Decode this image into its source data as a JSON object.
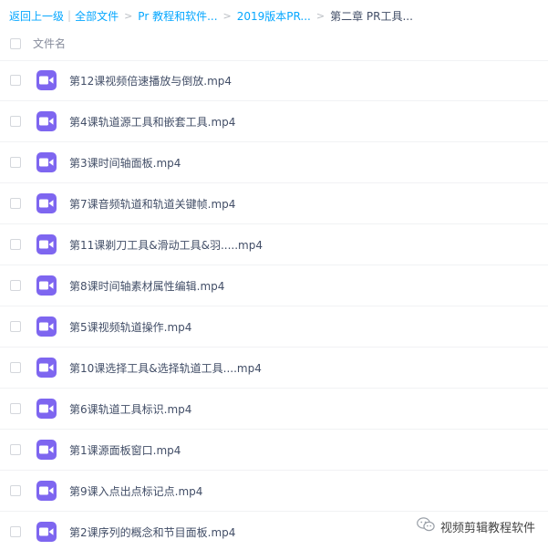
{
  "breadcrumb": {
    "back": "返回上一级",
    "divider": "|",
    "all_files": "全部文件",
    "level1": "Pr 教程和软件...",
    "level2": "2019版本PR...",
    "current": "第二章 PR工具...",
    "arrow": ">"
  },
  "header": {
    "column_label": "文件名"
  },
  "files": [
    {
      "name": "第12课视频倍速播放与倒放.mp4",
      "icon": "video-file-icon"
    },
    {
      "name": "第4课轨道源工具和嵌套工具.mp4",
      "icon": "video-file-icon"
    },
    {
      "name": "第3课时间轴面板.mp4",
      "icon": "video-file-icon"
    },
    {
      "name": "第7课音频轨道和轨道关键帧.mp4",
      "icon": "video-file-icon"
    },
    {
      "name": "第11课剃刀工具&滑动工具&羽.....mp4",
      "icon": "video-file-icon"
    },
    {
      "name": "第8课时间轴素材属性编辑.mp4",
      "icon": "video-file-icon"
    },
    {
      "name": "第5课视频轨道操作.mp4",
      "icon": "video-file-icon"
    },
    {
      "name": "第10课选择工具&选择轨道工具....mp4",
      "icon": "video-file-icon"
    },
    {
      "name": "第6课轨道工具标识.mp4",
      "icon": "video-file-icon"
    },
    {
      "name": "第1课源面板窗口.mp4",
      "icon": "video-file-icon"
    },
    {
      "name": "第9课入点出点标记点.mp4",
      "icon": "video-file-icon"
    },
    {
      "name": "第2课序列的概念和节目面板.mp4",
      "icon": "video-file-icon"
    }
  ],
  "watermark": {
    "text": "视频剪辑教程软件",
    "icon": "wechat-icon"
  },
  "colors": {
    "link": "#06a7ff",
    "file_icon": "#7e66f0",
    "text": "#424e67"
  }
}
